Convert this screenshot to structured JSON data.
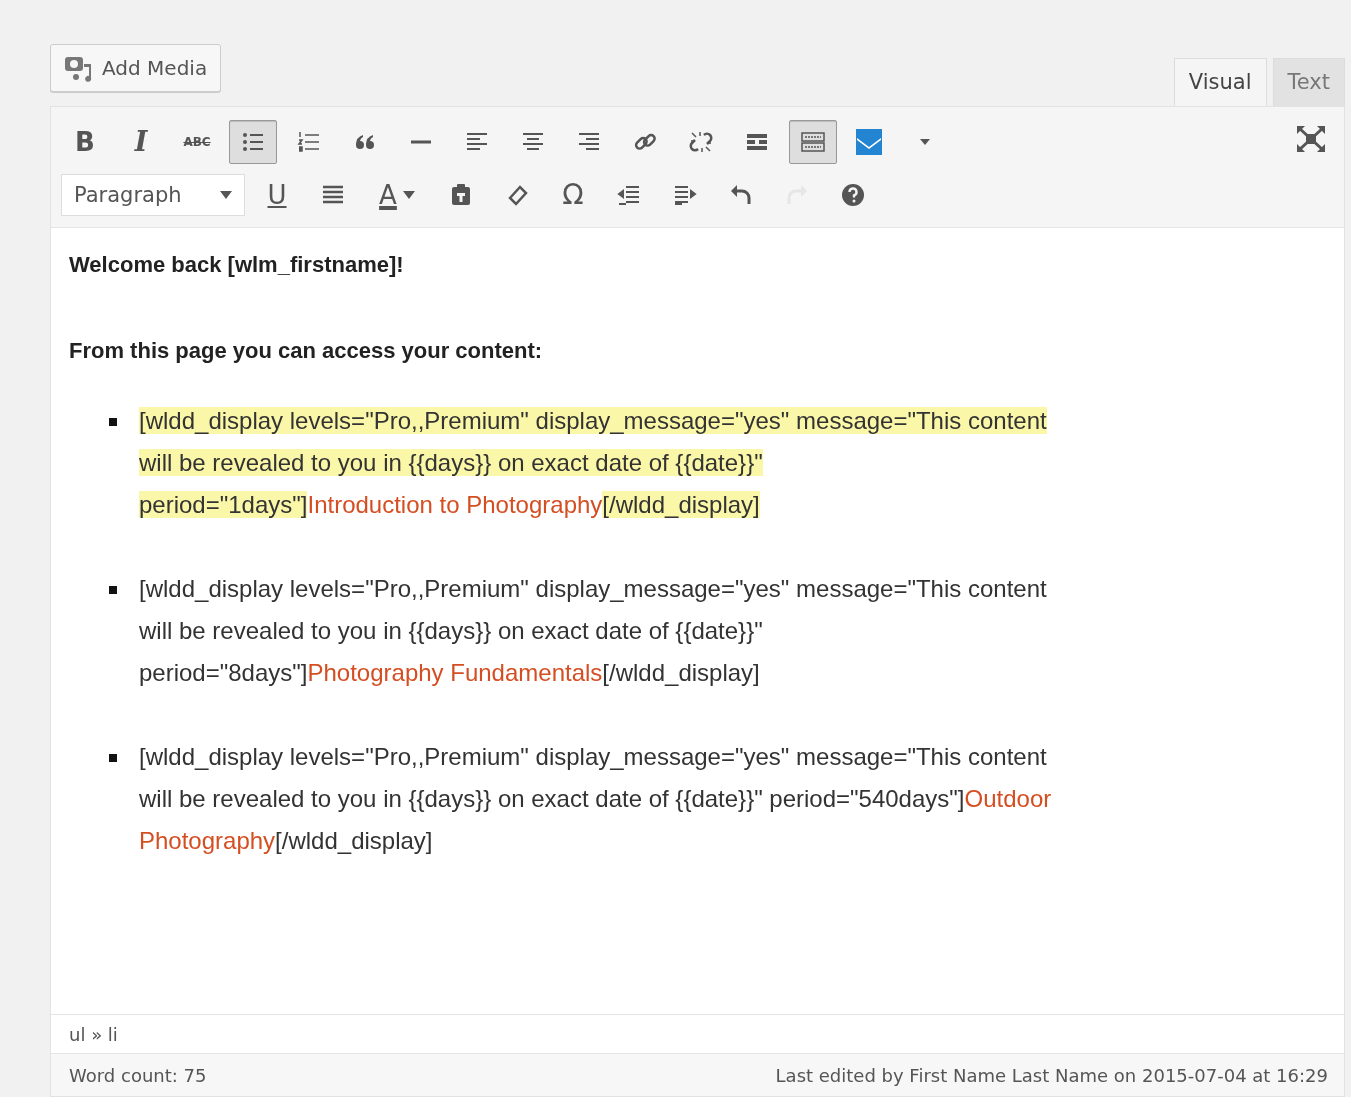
{
  "add_media": {
    "label": "Add Media"
  },
  "tabs": [
    {
      "label": "Visual",
      "selected": true
    },
    {
      "label": "Text",
      "selected": false
    }
  ],
  "toolbar_rows": [
    [
      {
        "kind": "bold",
        "label": "B",
        "active": false,
        "disabled": false
      },
      {
        "kind": "italic",
        "label": "I",
        "active": false,
        "disabled": false
      },
      {
        "kind": "strike",
        "label": "ABC",
        "active": false,
        "disabled": false
      },
      {
        "kind": "bullets",
        "active": true,
        "disabled": false
      },
      {
        "kind": "numbers",
        "active": false,
        "disabled": false
      },
      {
        "kind": "quote",
        "active": false,
        "disabled": false
      },
      {
        "kind": "hr",
        "active": false,
        "disabled": false
      },
      {
        "kind": "align-left",
        "active": false,
        "disabled": false
      },
      {
        "kind": "align-center",
        "active": false,
        "disabled": false
      },
      {
        "kind": "align-right",
        "active": false,
        "disabled": false
      },
      {
        "kind": "link",
        "active": false,
        "disabled": false
      },
      {
        "kind": "unlink",
        "active": false,
        "disabled": false
      },
      {
        "kind": "more",
        "active": false,
        "disabled": false
      },
      {
        "kind": "kitchen-sink",
        "active": true,
        "disabled": false
      },
      {
        "kind": "plugin",
        "active": false,
        "disabled": false
      },
      {
        "kind": "caret",
        "active": false,
        "disabled": false
      }
    ],
    [
      {
        "kind": "select",
        "label": "Paragraph"
      },
      {
        "kind": "underline",
        "label": "U",
        "active": false,
        "disabled": false
      },
      {
        "kind": "justify",
        "active": false,
        "disabled": false
      },
      {
        "kind": "color",
        "label": "A",
        "active": false,
        "disabled": false
      },
      {
        "kind": "paste",
        "active": false,
        "disabled": false
      },
      {
        "kind": "eraser",
        "active": false,
        "disabled": false
      },
      {
        "kind": "char",
        "label": "Ω",
        "active": false,
        "disabled": false
      },
      {
        "kind": "outdent",
        "active": false,
        "disabled": false
      },
      {
        "kind": "indent",
        "active": false,
        "disabled": false
      },
      {
        "kind": "undo",
        "active": false,
        "disabled": false
      },
      {
        "kind": "redo",
        "active": false,
        "disabled": true
      },
      {
        "kind": "help",
        "active": false,
        "disabled": false
      }
    ]
  ],
  "content": {
    "heading": "Welcome back [wlm_firstname]!",
    "subheading": "From this page you can access your content:",
    "items": [
      {
        "opening": "[wldd_display levels=\"Pro,,Premium\" display_message=\"yes\" message=\"This content will be revealed to you in {{days}} on exact date of {{date}}\" period=\"1days\"]",
        "title": "Introduction to Photography",
        "closing": "[/wldd_display]",
        "highlighted": true
      },
      {
        "opening": "[wldd_display levels=\"Pro,,Premium\" display_message=\"yes\" message=\"This content will be revealed to you in {{days}} on exact date of {{date}}\" period=\"8days\"]",
        "title": "Photography Fundamentals",
        "closing": "[/wldd_display]",
        "highlighted": false
      },
      {
        "opening": "[wldd_display levels=\"Pro,,Premium\" display_message=\"yes\" message=\"This content will be revealed to you in {{days}} on exact date of {{date}}\" period=\"540days\"]",
        "title": "Outdoor Photography",
        "closing": "[/wldd_display]",
        "highlighted": false
      }
    ]
  },
  "path": "ul » li",
  "status_bar": {
    "word_count": "Word count: 75",
    "last_edited": "Last edited by First Name Last Name on 2015-07-04 at 16:29"
  }
}
